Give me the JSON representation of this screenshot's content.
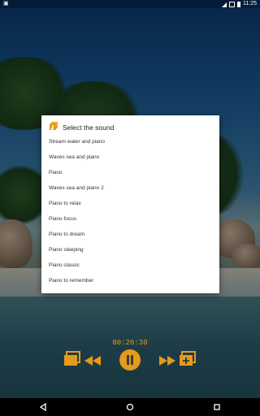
{
  "status_bar": {
    "time": "11:25"
  },
  "dialog": {
    "title": "Select the sound",
    "options": [
      "Stream water and piano",
      "Waves sea and piano",
      "Piano",
      "Waves sea and piano 2",
      "Piano to relax",
      "Piano focus",
      "Piano to dream",
      "Piano sleeping",
      "Piano classic",
      "Piano to remember"
    ]
  },
  "player": {
    "elapsed": "00:26:30"
  },
  "colors": {
    "accent": "#e59a1a",
    "dialog_bg": "#ffffff"
  },
  "icons": [
    "playlist-icon",
    "rewind-icon",
    "pause-icon",
    "fast-forward-icon",
    "add-playlist-icon",
    "back-icon",
    "home-icon",
    "recents-icon"
  ]
}
